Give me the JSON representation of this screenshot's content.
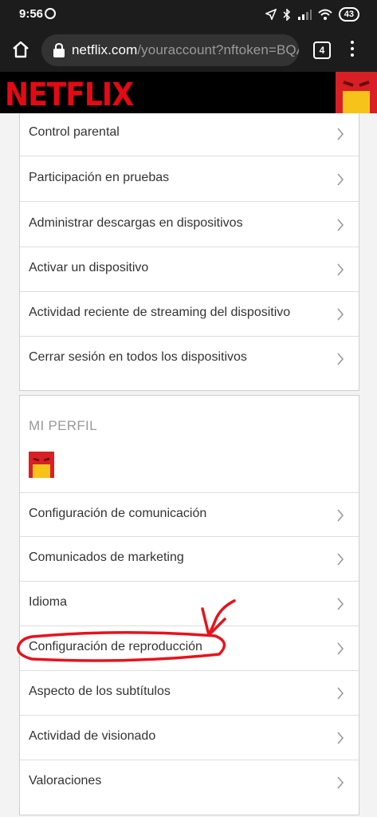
{
  "status_bar": {
    "time": "9:56",
    "battery": "43"
  },
  "browser": {
    "url_host": "netflix.com",
    "url_rest": "/youraccount?nftoken=BQA",
    "tab_count": "4"
  },
  "header": {
    "logo_text": "NETFLIX",
    "brand_color": "#e50914"
  },
  "account_settings": {
    "items": [
      {
        "label": "Control parental"
      },
      {
        "label": "Participación en pruebas"
      },
      {
        "label": "Administrar descargas en dispositivos"
      },
      {
        "label": "Activar un dispositivo"
      },
      {
        "label": "Actividad reciente de streaming del dispositivo"
      },
      {
        "label": "Cerrar sesión en todos los dispositivos"
      }
    ]
  },
  "profile": {
    "section_title": "MI PERFIL",
    "items": [
      {
        "label": "Configuración de comunicación"
      },
      {
        "label": "Comunicados de marketing"
      },
      {
        "label": "Idioma"
      },
      {
        "label": "Configuración de reproducción",
        "highlighted": true
      },
      {
        "label": "Aspecto de los subtítulos"
      },
      {
        "label": "Actividad de visionado"
      },
      {
        "label": "Valoraciones"
      }
    ]
  },
  "annotation_color": "#e8131b"
}
